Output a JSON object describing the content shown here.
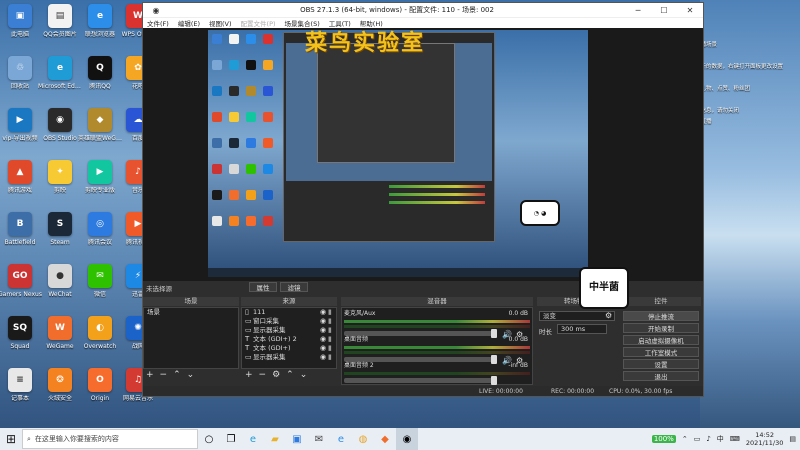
{
  "desktop": {
    "icons": [
      {
        "label": "此电脑",
        "color": "#3b7fd4",
        "glyph": "▣"
      },
      {
        "label": "QQ会员图片",
        "color": "#f2f2f2",
        "glyph": "▤"
      },
      {
        "label": "联想浏览器",
        "color": "#2c8ee8",
        "glyph": "e"
      },
      {
        "label": "WPS Office",
        "color": "#d9322f",
        "glyph": "W"
      },
      {
        "label": "回收站",
        "color": "#7aa7d6",
        "glyph": "♲"
      },
      {
        "label": "Microsoft Edge",
        "color": "#1f9bd6",
        "glyph": "e"
      },
      {
        "label": "腾讯QQ",
        "color": "#111111",
        "glyph": "Q"
      },
      {
        "label": "花吧",
        "color": "#f5a623",
        "glyph": "✿"
      },
      {
        "label": "vip-导出视频",
        "color": "#1a78c2",
        "glyph": "▶"
      },
      {
        "label": "OBS Studio",
        "color": "#2a2a2a",
        "glyph": "◉"
      },
      {
        "label": "英雄联盟WeGame版",
        "color": "#b08a2c",
        "glyph": "◆"
      },
      {
        "label": "百度",
        "color": "#2a55d4",
        "glyph": "☁"
      },
      {
        "label": "腾讯游戏",
        "color": "#e04a2b",
        "glyph": "▲"
      },
      {
        "label": "剪映",
        "color": "#f7c932",
        "glyph": "✦"
      },
      {
        "label": "剪映专业版",
        "color": "#12c6a0",
        "glyph": "▶"
      },
      {
        "label": "音乐",
        "color": "#e8532f",
        "glyph": "♪"
      },
      {
        "label": "Battlefield",
        "color": "#3d6ea8",
        "glyph": "B"
      },
      {
        "label": "Steam",
        "color": "#1b2838",
        "glyph": "S"
      },
      {
        "label": "腾讯会议",
        "color": "#2d7be0",
        "glyph": "◎"
      },
      {
        "label": "腾讯视频",
        "color": "#f05a28",
        "glyph": "▶"
      },
      {
        "label": "Gamers Nexus",
        "color": "#cc3333",
        "glyph": "GO"
      },
      {
        "label": "WeChat",
        "color": "#d8d8d8",
        "glyph": "●"
      },
      {
        "label": "微信",
        "color": "#2dc100",
        "glyph": "✉"
      },
      {
        "label": "迅雷",
        "color": "#1e88e5",
        "glyph": "⚡"
      },
      {
        "label": "Squad",
        "color": "#1a1a1a",
        "glyph": "SQ"
      },
      {
        "label": "WeGame",
        "color": "#f06d2c",
        "glyph": "W"
      },
      {
        "label": "Overwatch",
        "color": "#f3a01b",
        "glyph": "◐"
      },
      {
        "label": "战网",
        "color": "#1b63c8",
        "glyph": "✺"
      },
      {
        "label": "记事本",
        "color": "#e8e8e8",
        "glyph": "≡"
      },
      {
        "label": "火绒安全",
        "color": "#f58220",
        "glyph": "❂"
      },
      {
        "label": "Origin",
        "color": "#f56c2d",
        "glyph": "O"
      },
      {
        "label": "网易云音乐",
        "color": "#d33a31",
        "glyph": "♫"
      }
    ]
  },
  "obs": {
    "title": "OBS 27.1.3 (64-bit, windows) - 配置文件: 110 - 场景: 002",
    "menu": [
      "文件(F)",
      "编辑(E)",
      "视图(V)",
      "配置文件(P)",
      "场景集合(S)",
      "工具(T)",
      "帮助(H)"
    ],
    "watermark": "菜鸟实验室",
    "stamp_big": "中半菌",
    "scenes_header": "场景",
    "scenes": [
      "场景"
    ],
    "sources_header": "来源",
    "sources": [
      {
        "name": "111",
        "icon": "▯"
      },
      {
        "name": "窗口采集",
        "icon": "▭"
      },
      {
        "name": "显示器采集",
        "icon": "▭"
      },
      {
        "name": "文本 (GDI+) 2",
        "icon": "T"
      },
      {
        "name": "文本 (GDI+)",
        "icon": "T"
      },
      {
        "name": "显示器采集",
        "icon": "▭"
      }
    ],
    "mixer_header": "混音器",
    "mixer": [
      {
        "name": "麦克风/Aux",
        "db": "0.0 dB"
      },
      {
        "name": "桌面音频",
        "db": "0.0 dB"
      },
      {
        "name": "桌面音频 2",
        "db": "-inf dB"
      }
    ],
    "transitions_header": "转场特效",
    "transition": "淡变",
    "duration_label": "时长",
    "duration": "300 ms",
    "controls_header": "控件",
    "controls": [
      "停止推流",
      "开始录制",
      "启动虚拟摄像机",
      "工作室模式",
      "设置",
      "退出"
    ],
    "status": {
      "live": "LIVE: 00:00:00",
      "rec": "REC: 00:00:00",
      "cpu": "CPU: 0.0%, 30.00 fps"
    },
    "tabs": [
      "属性",
      "滤镜"
    ],
    "label_scene_none": "未选择源"
  },
  "notices": [
    "这里展示本次直播场景",
    "左键选择场景",
    "左上角可以添加新的数据，右键打开面板更改设置",
    "右上角添加视频",
    "这里显示弹幕、礼物、点赞、粉丝团",
    "等内容",
    "这里显示录制的信息，请勿关闭",
    "左侧菜单可设置直播"
  ],
  "taskbar": {
    "search_placeholder": "在这里输入你要搜索的内容",
    "time": "14:52",
    "date": "2021/11/30",
    "lang": "中",
    "battery": "100%"
  }
}
